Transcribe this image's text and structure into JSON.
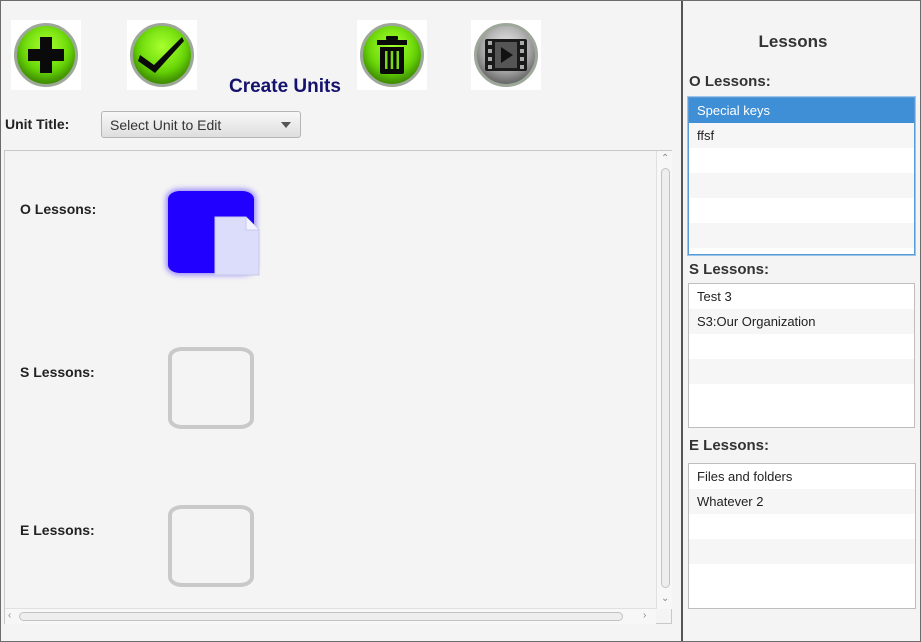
{
  "header": {
    "title": "Create Units"
  },
  "toolbar": {
    "buttons": [
      {
        "name": "add-button",
        "icon": "plus-icon"
      },
      {
        "name": "confirm-button",
        "icon": "checkmark-icon"
      },
      {
        "name": "delete-button",
        "icon": "trash-icon"
      },
      {
        "name": "video-button",
        "icon": "film-play-icon"
      }
    ]
  },
  "unit_form": {
    "label": "Unit Title:",
    "select_value": "Select Unit to Edit"
  },
  "drop_zones": [
    {
      "label": "O Lessons:",
      "filled": true
    },
    {
      "label": "S Lessons:",
      "filled": false
    },
    {
      "label": "E Lessons:",
      "filled": false
    }
  ],
  "sidebar": {
    "title": "Lessons",
    "groups": [
      {
        "label": "O Lessons:",
        "items": [
          "Special keys",
          "ffsf",
          "",
          "",
          "",
          ""
        ],
        "selected": 0
      },
      {
        "label": "S Lessons:",
        "items": [
          "Test 3",
          "S3:Our Organization",
          "",
          "",
          "",
          ""
        ],
        "selected": -1
      },
      {
        "label": "E Lessons:",
        "items": [
          "Files and folders",
          "Whatever 2",
          "",
          "",
          "",
          ""
        ],
        "selected": -1
      }
    ]
  },
  "colors": {
    "title": "#15126e",
    "accent_green": "#66d606",
    "drop_filled": "#2200ff",
    "selection": "#3f8fd7"
  }
}
